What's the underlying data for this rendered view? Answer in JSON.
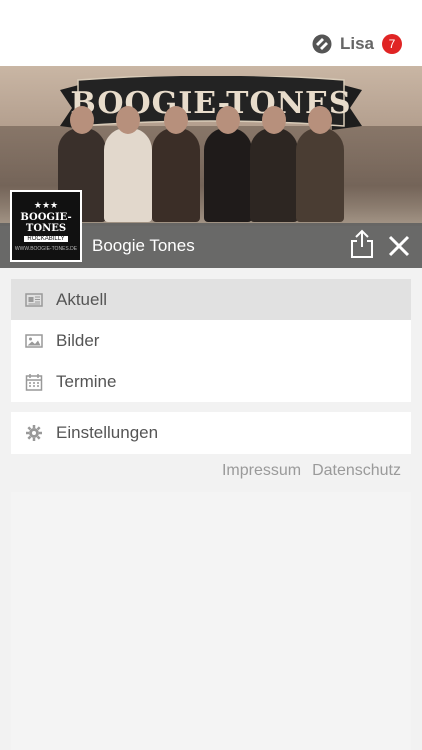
{
  "header": {
    "user_name": "Lisa",
    "notification_count": "7",
    "user_icon": "app-logo-icon",
    "badge_color": "#e02424"
  },
  "hero": {
    "banner_text": "BOOGIE-TONES",
    "logo": {
      "stars": "★★★",
      "name": "BOOGIE-TONES",
      "tagline": "ROCKABILLY",
      "url": "WWW.BOOGIE-TONES.DE"
    }
  },
  "profile": {
    "name": "Boogie Tones",
    "share_icon": "share-icon",
    "close_icon": "close-icon"
  },
  "menu": {
    "items": [
      {
        "label": "Aktuell",
        "icon": "newspaper-icon",
        "active": true
      },
      {
        "label": "Bilder",
        "icon": "image-icon",
        "active": false
      },
      {
        "label": "Termine",
        "icon": "calendar-icon",
        "active": false
      }
    ],
    "settings_label": "Einstellungen",
    "settings_icon": "gear-icon"
  },
  "footer": {
    "impressum": "Impressum",
    "datenschutz": "Datenschutz"
  }
}
